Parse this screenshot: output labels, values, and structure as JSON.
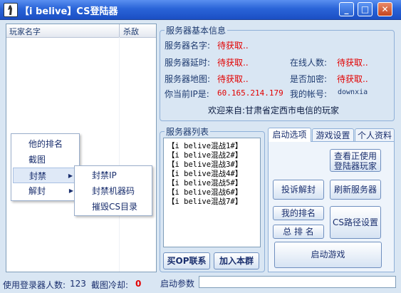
{
  "window": {
    "title": "【i belive】CS登陆器",
    "minimize": "_",
    "maximize": "□",
    "close": "✕"
  },
  "player_list": {
    "columns": [
      "玩家名字",
      "杀敌"
    ]
  },
  "context_menu": {
    "items": [
      "他的排名",
      "截图",
      "封禁",
      "解封"
    ],
    "submenu": [
      "封禁IP",
      "封禁机器码",
      "摧毁CS目录"
    ]
  },
  "server_info": {
    "legend": "服务器基本信息",
    "name_label": "服务器名字:",
    "name_value": "待获取..",
    "latency_label": "服务器延时:",
    "latency_value": "待获取..",
    "online_label": "在线人数:",
    "online_value": "待获取..",
    "map_label": "服务器地图:",
    "map_value": "待获取..",
    "encrypt_label": "是否加密:",
    "encrypt_value": "待获取..",
    "ip_label": "你当前IP是:",
    "ip_value": "60.165.214.179",
    "account_label": "我的帐号:",
    "account_value": "downxia",
    "welcome": "欢迎来自:甘肃省定西市电信的玩家"
  },
  "server_list": {
    "legend": "服务器列表",
    "servers": [
      "【i belive混战1#】",
      "【i belive混战2#】",
      "【i belive混战3#】",
      "【i belive混战4#】",
      "【i belive混战5#】",
      "【i belive混战6#】",
      "【i belive混战7#】"
    ],
    "buy_button": "买OP联系",
    "join_button": "加入本群"
  },
  "tabs": [
    "启动选项",
    "游戏设置",
    "个人资料"
  ],
  "startup": {
    "view_users": "查看正使用登陆器玩家",
    "appeal_unban": "投诉解封",
    "refresh": "刷新服务器",
    "my_rank": "我的排名",
    "total_rank": "总 排 名",
    "cs_path": "CS路径设置",
    "launch": "启动游戏"
  },
  "status": {
    "users_label": "使用登录器人数:",
    "users_value": "123",
    "cooldown_label": "截图冷却:",
    "cooldown_value": "0",
    "params_label": "启动参数",
    "params_value": ""
  },
  "colors": {
    "title_bar": "#2a64d8",
    "window_bg": "#d9e6f3",
    "value_red": "#e20000",
    "label_blue": "#1e3b70"
  }
}
